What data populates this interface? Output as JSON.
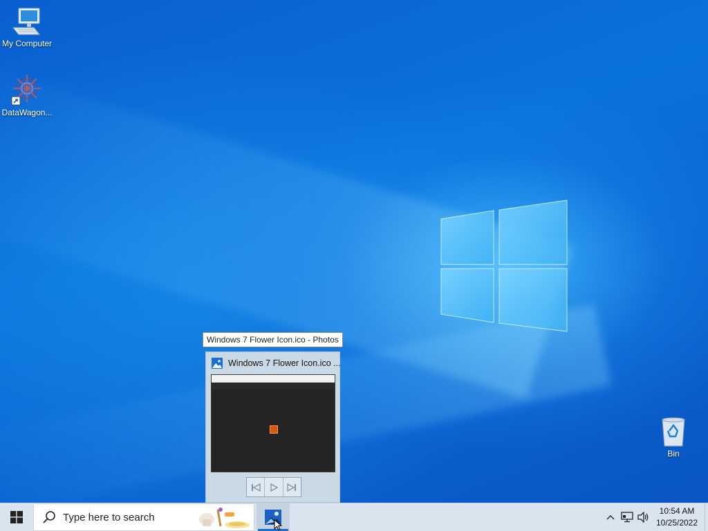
{
  "desktop": {
    "icons": [
      {
        "label": "My Computer",
        "icon": "computer-icon"
      },
      {
        "label": "DataWagon...",
        "icon": "datawagon-app-icon"
      },
      {
        "label": "Bin",
        "icon": "recycle-bin-icon"
      }
    ]
  },
  "preview": {
    "tooltip": "Windows 7 Flower Icon.ico - Photos",
    "window_title": "Windows 7 Flower Icon.ico ...",
    "app_icon": "photos-icon",
    "controls": [
      "previous-icon",
      "play-icon",
      "next-icon"
    ]
  },
  "taskbar": {
    "start_icon": "windows-start-icon",
    "search_placeholder": "Type here to search",
    "pinned_app": "photos-icon",
    "tray": {
      "icons": [
        "chevron-up-icon",
        "network-icon",
        "volume-icon"
      ],
      "time": "10:54 AM",
      "date": "10/25/2022"
    }
  },
  "colors": {
    "desktop_blue": "#0a6fd8",
    "taskbar": "#d9e4ee",
    "active_underline": "#1a6fd1"
  }
}
